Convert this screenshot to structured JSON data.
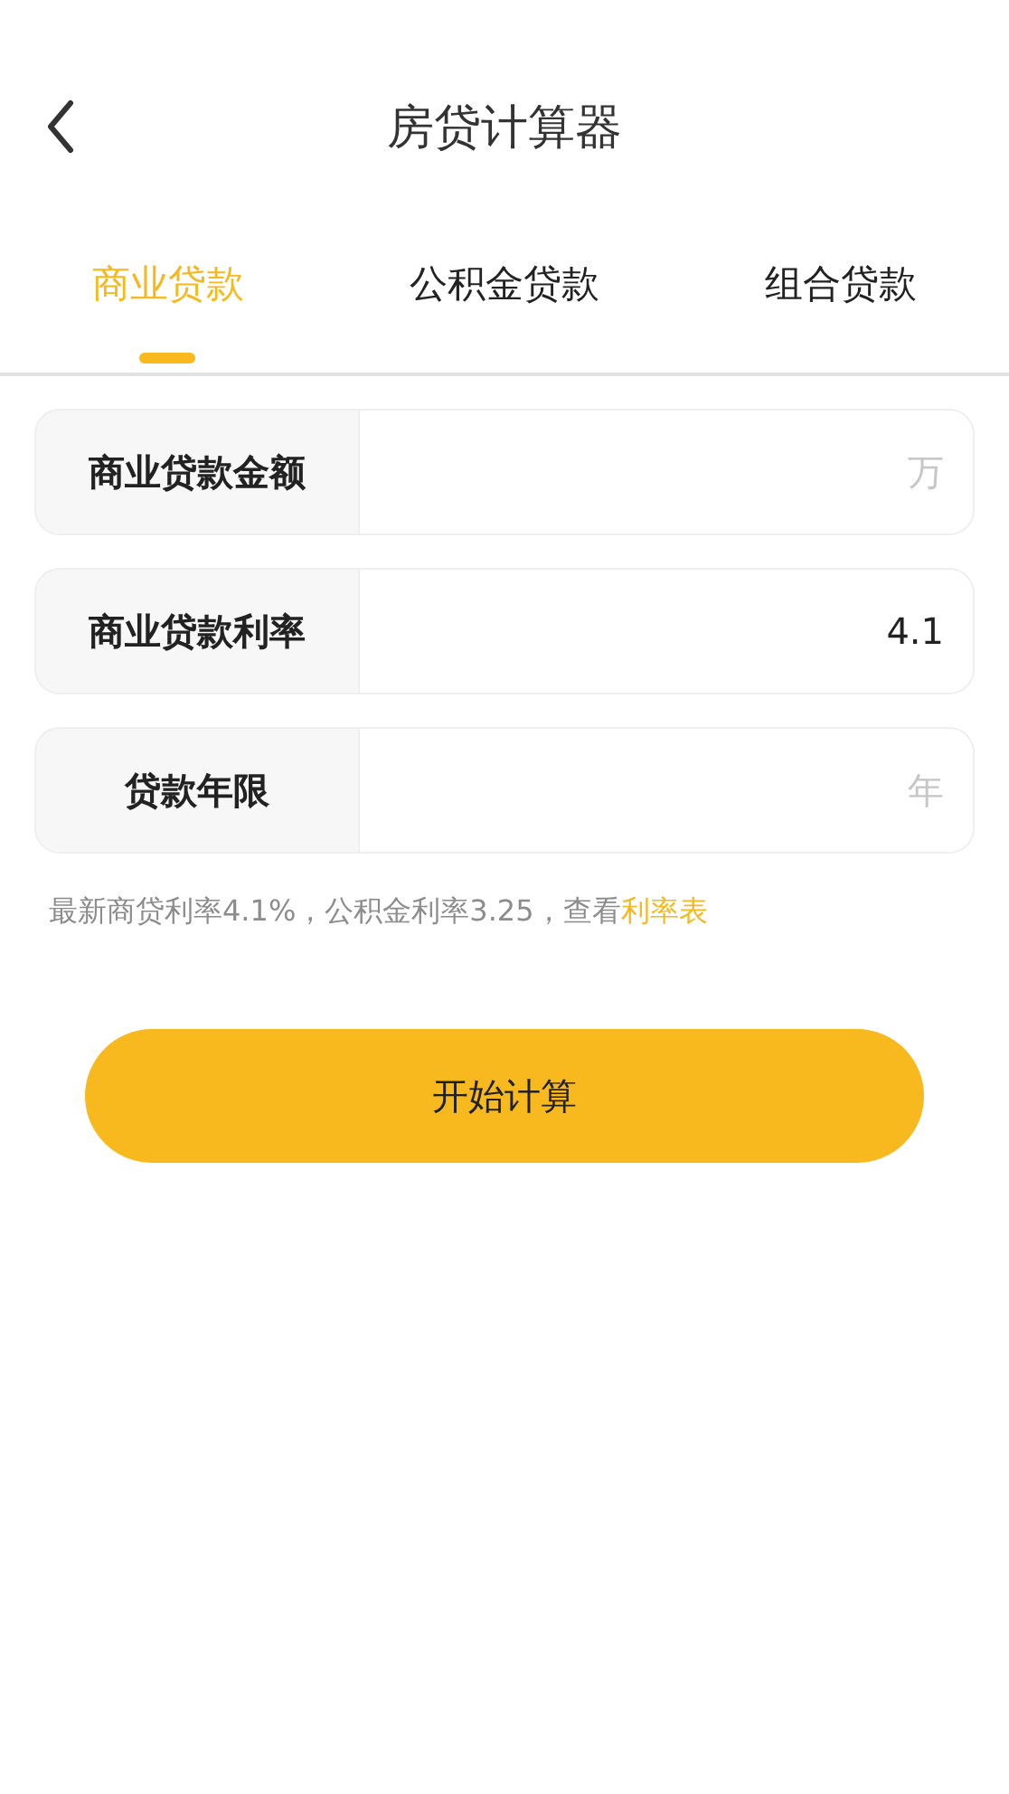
{
  "header": {
    "title": "房贷计算器"
  },
  "tabs": [
    {
      "label": "商业贷款",
      "selected": true
    },
    {
      "label": "公积金贷款",
      "selected": false
    },
    {
      "label": "组合贷款",
      "selected": false
    }
  ],
  "fields": [
    {
      "label": "商业贷款金额",
      "placeholder": "万"
    },
    {
      "label": "商业贷款利率",
      "value": "4.1"
    },
    {
      "label": "贷款年限",
      "placeholder": "年"
    }
  ],
  "hint": {
    "text": "最新商贷利率4.1%，公积金利率3.25，查看",
    "link": "利率表"
  },
  "submit_button": "开始计算"
}
